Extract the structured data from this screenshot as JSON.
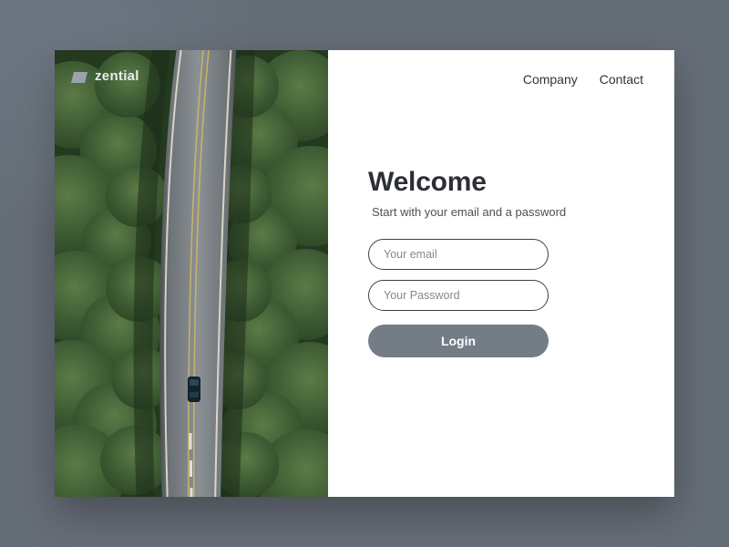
{
  "brand": {
    "name": "zential"
  },
  "nav": {
    "company": "Company",
    "contact": "Contact"
  },
  "form": {
    "title": "Welcome",
    "subtitle": "Start with your email and a password",
    "emailPlaceholder": "Your email",
    "passwordPlaceholder": "Your Password",
    "loginLabel": "Login"
  },
  "colors": {
    "buttonBg": "#747c86",
    "pageBg": "#656d77"
  }
}
